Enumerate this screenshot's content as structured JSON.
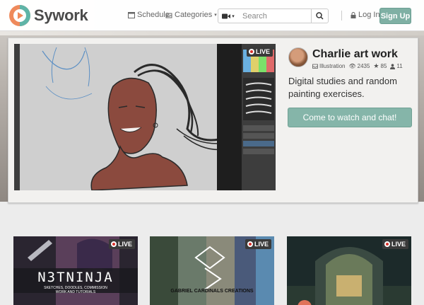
{
  "brand": {
    "name": "Sywork"
  },
  "nav": {
    "schedule_label": "Schedule",
    "categories_label": "Categories",
    "search_placeholder": "Search",
    "login_label": "Log In",
    "signup_label": "Sign Up"
  },
  "featured": {
    "live_label": "LIVE",
    "streamer_name": "Charlie art work",
    "category": "Illustration",
    "views": "2435",
    "stars": "85",
    "followers": "11",
    "description": "Digital studies and random painting exercises.",
    "cta_label": "Come to watch and chat!"
  },
  "streams": [
    {
      "live_label": "LIVE",
      "title": "N3TNINJA",
      "subtitle": "SKETCHES, DOODLES, COMMISSION WORK AND TUTORIALS"
    },
    {
      "live_label": "LIVE",
      "title": "GABRIEL CARDINALS CREATIONS"
    },
    {
      "live_label": "LIVE"
    }
  ],
  "colors": {
    "accent": "#85b5a9",
    "live_red": "#d9322b",
    "logo_orange": "#ef8a5b",
    "logo_teal": "#5fb4a7"
  }
}
